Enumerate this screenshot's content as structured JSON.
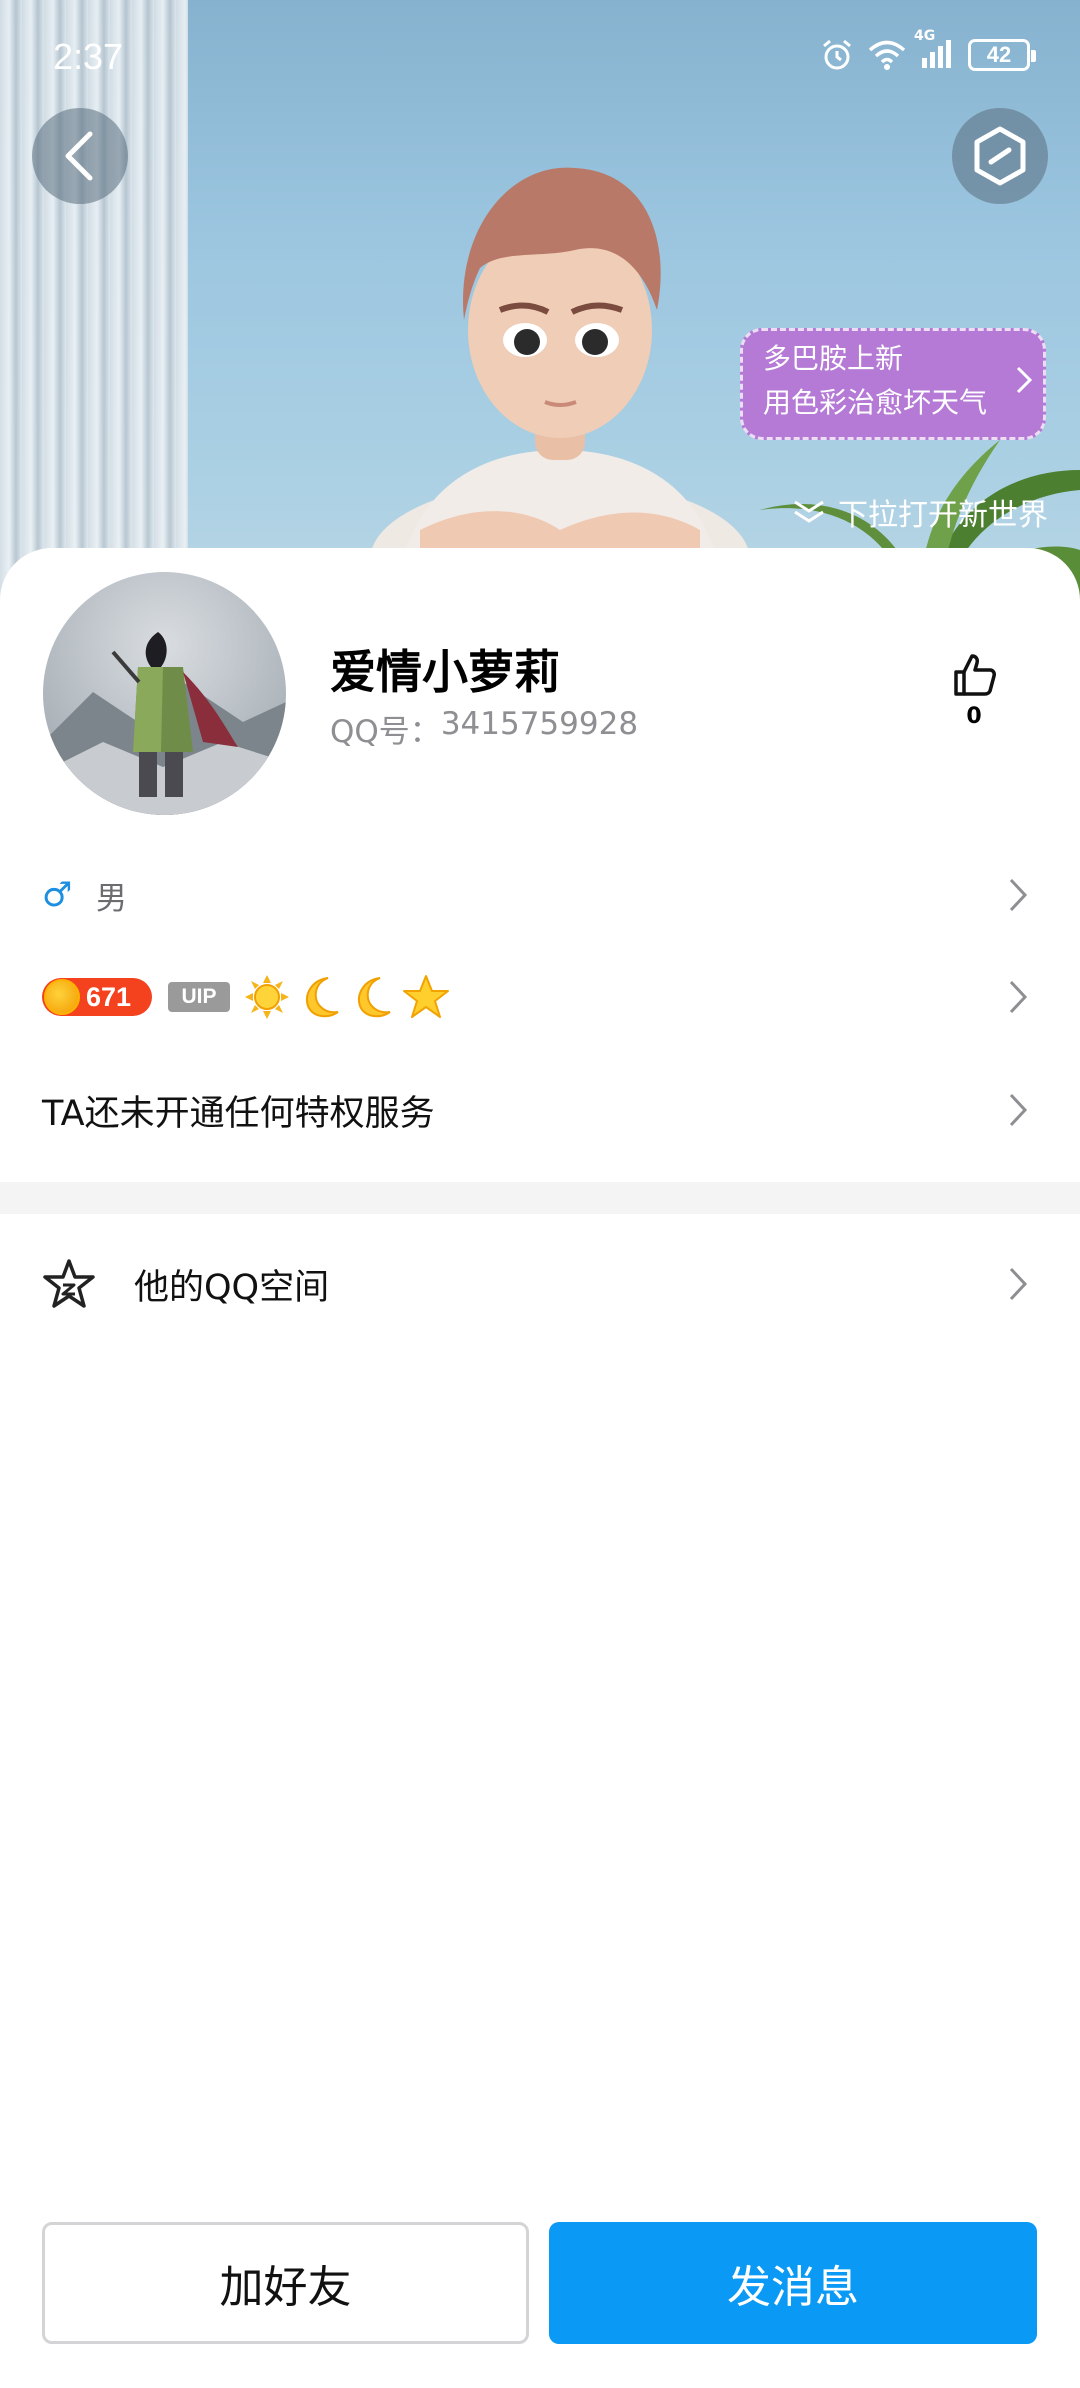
{
  "status_bar": {
    "time": "2:37",
    "network": "4G",
    "battery": "42"
  },
  "hero": {
    "promo_line1": "多巴胺上新",
    "promo_line2": "用色彩治愈坏天气",
    "pull_hint": "下拉打开新世界"
  },
  "profile": {
    "nickname": "爱情小萝莉",
    "qq_label": "QQ号：",
    "qq_number": "3415759928",
    "likes": "0"
  },
  "info": {
    "gender_symbol": "♂",
    "gender": "男",
    "level": "671",
    "vip_label": "UIP",
    "level_icons": [
      "sun-icon",
      "moon-icon",
      "moon-icon",
      "star-icon"
    ],
    "privilege_text": "TA还未开通任何特权服务"
  },
  "space": {
    "label": "他的QQ空间"
  },
  "actions": {
    "add_friend": "加好友",
    "send_message": "发消息"
  },
  "colors": {
    "accent": "#0a9af5",
    "level_badge": "#f4421f",
    "promo": "#b57ad6",
    "gender_icon": "#1e8fe0"
  }
}
